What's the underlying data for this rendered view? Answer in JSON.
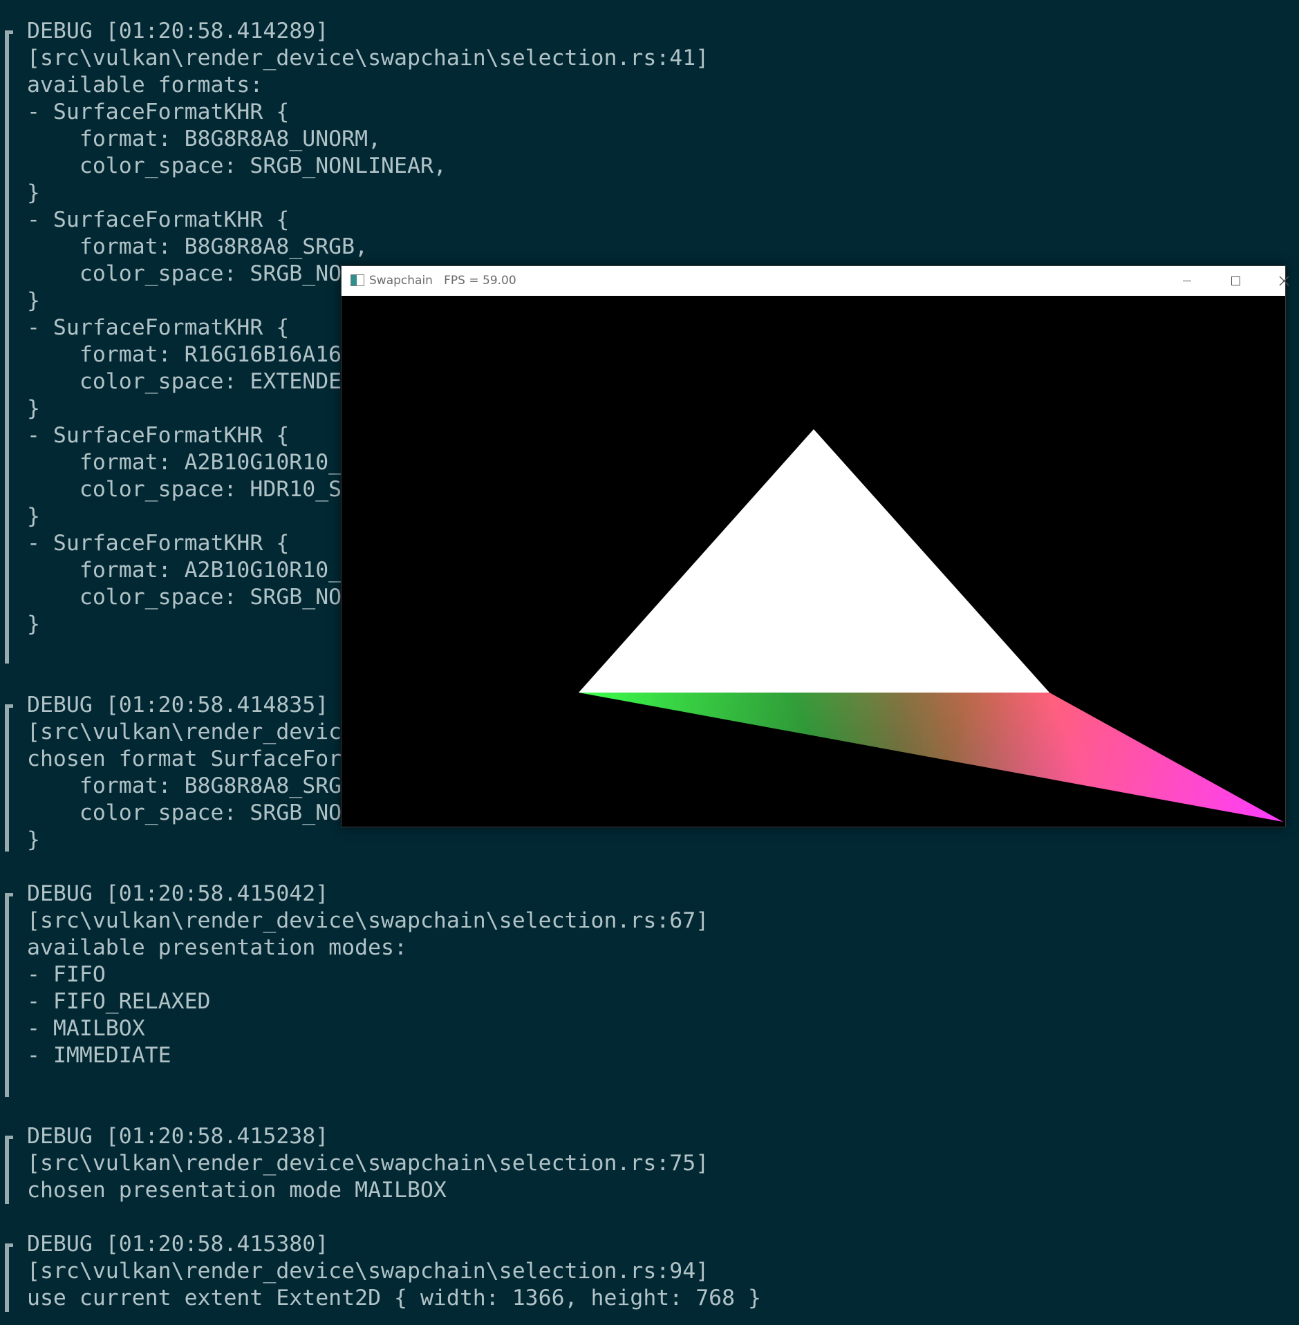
{
  "terminal": {
    "lines": [
      "DEBUG [01:20:58.414289]",
      "[src\\vulkan\\render_device\\swapchain\\selection.rs:41]",
      "available formats:",
      "- SurfaceFormatKHR {",
      "    format: B8G8R8A8_UNORM,",
      "    color_space: SRGB_NONLINEAR,",
      "}",
      "- SurfaceFormatKHR {",
      "    format: B8G8R8A8_SRGB,",
      "    color_space: SRGB_NO",
      "}",
      "- SurfaceFormatKHR {",
      "    format: R16G16B16A16",
      "    color_space: EXTENDE",
      "}",
      "- SurfaceFormatKHR {",
      "    format: A2B10G10R10_",
      "    color_space: HDR10_S",
      "}",
      "- SurfaceFormatKHR {",
      "    format: A2B10G10R10_",
      "    color_space: SRGB_NO",
      "}",
      "DEBUG [01:20:58.414835]",
      "[src\\vulkan\\render_devic",
      "chosen format SurfaceFor",
      "    format: B8G8R8A8_SRG",
      "    color_space: SRGB_NO",
      "}",
      "DEBUG [01:20:58.415042]",
      "[src\\vulkan\\render_device\\swapchain\\selection.rs:67]",
      "available presentation modes:",
      "- FIFO",
      "- FIFO_RELAXED",
      "- MAILBOX",
      "- IMMEDIATE",
      "DEBUG [01:20:58.415238]",
      "[src\\vulkan\\render_device\\swapchain\\selection.rs:75]",
      "chosen presentation mode MAILBOX",
      "DEBUG [01:20:58.415380]",
      "[src\\vulkan\\render_device\\swapchain\\selection.rs:94]",
      "use current extent Extent2D { width: 1366, height: 768 }"
    ]
  },
  "window": {
    "title": "Swapchain   FPS = 59.00",
    "icons": {
      "app": "app-window-icon",
      "minimize": "minimize-icon",
      "maximize": "maximize-icon",
      "close": "close-icon"
    },
    "scene": {
      "background": "#000000",
      "triangle_fill": "#ffffff",
      "gradient_colors": [
        "#22ff33",
        "#ff1133",
        "#3311ff"
      ]
    }
  }
}
